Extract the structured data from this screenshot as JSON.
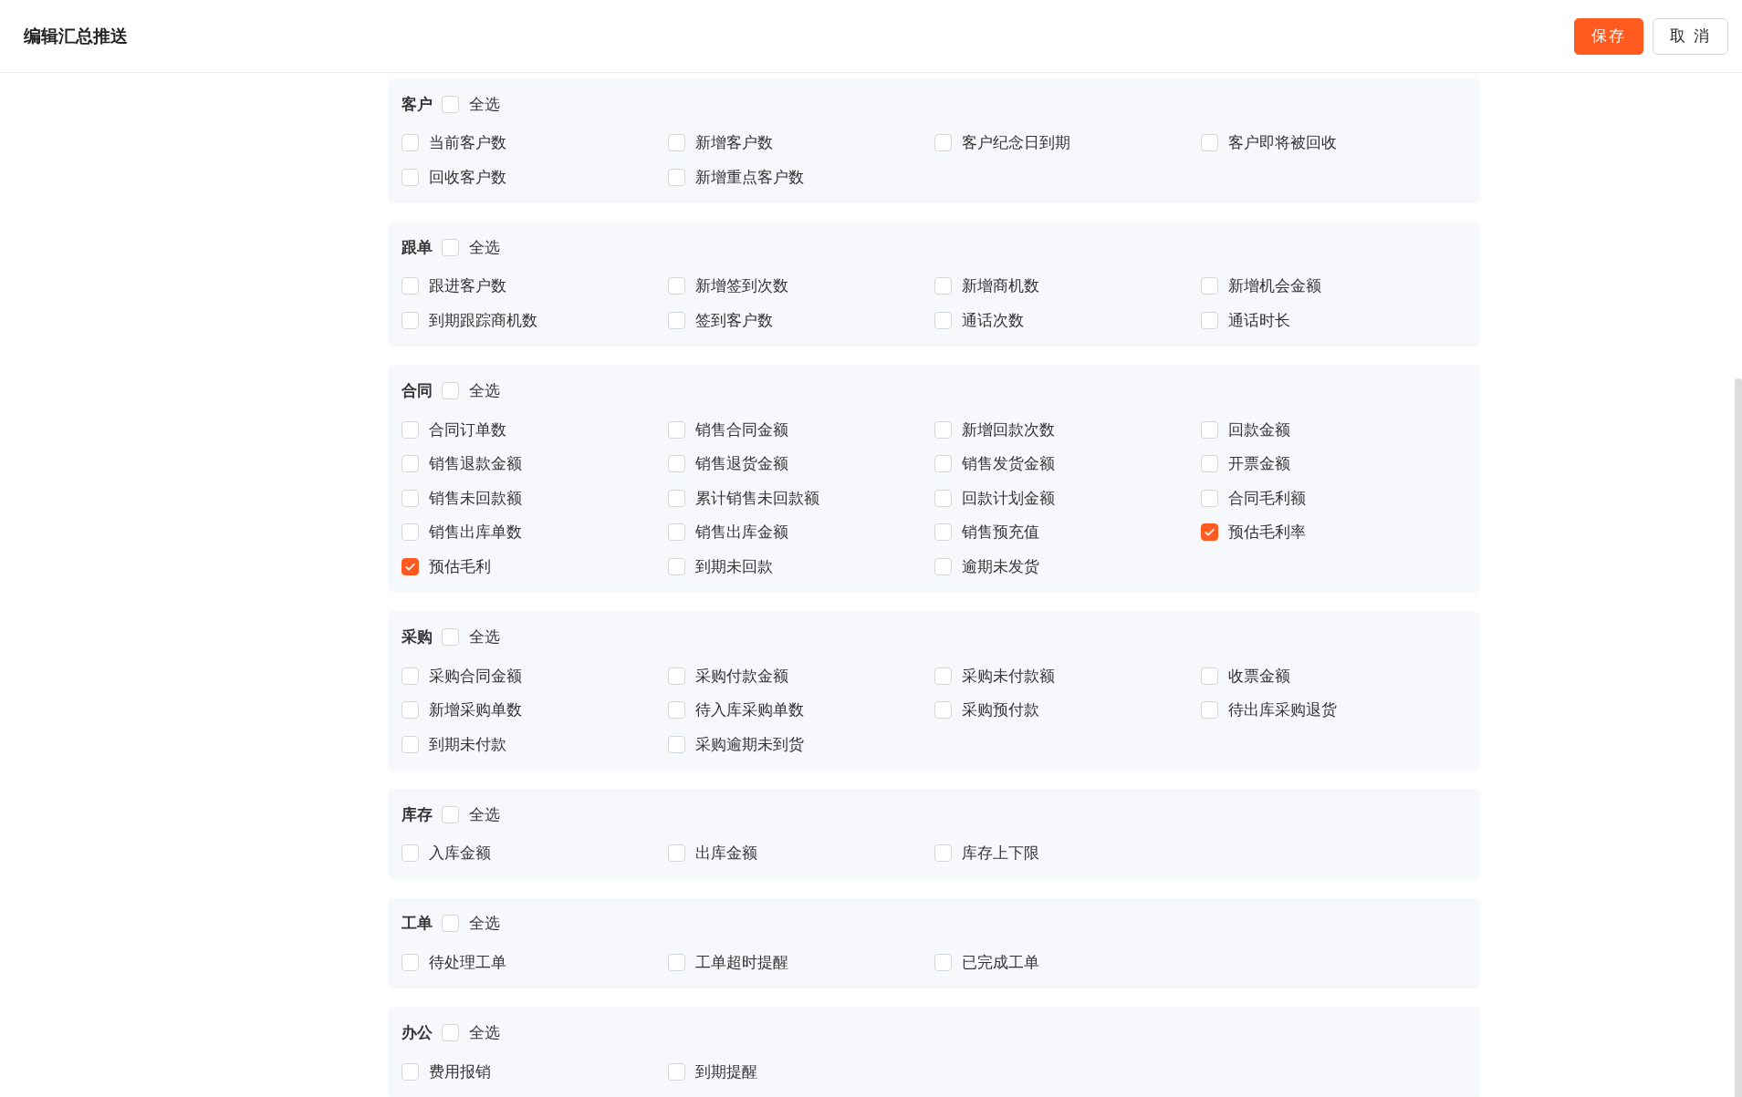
{
  "header": {
    "title": "编辑汇总推送",
    "buttons": [
      {
        "kind": "primary",
        "label": "保存"
      },
      {
        "kind": "default",
        "label": "取 消"
      }
    ]
  },
  "sections": [
    {
      "title": "客户",
      "select_all": {
        "label": "全选",
        "checked": false
      },
      "items": [
        {
          "label": "当前客户数",
          "checked": false
        },
        {
          "label": "新增客户数",
          "checked": false
        },
        {
          "label": "客户纪念日到期",
          "checked": false
        },
        {
          "label": "客户即将被回收",
          "checked": false
        },
        {
          "label": "回收客户数",
          "checked": false
        },
        {
          "label": "新增重点客户数",
          "checked": false
        }
      ]
    },
    {
      "title": "跟单",
      "select_all": {
        "label": "全选",
        "checked": false
      },
      "items": [
        {
          "label": "跟进客户数",
          "checked": false
        },
        {
          "label": "新增签到次数",
          "checked": false
        },
        {
          "label": "新增商机数",
          "checked": false
        },
        {
          "label": "新增机会金额",
          "checked": false
        },
        {
          "label": "到期跟踪商机数",
          "checked": false
        },
        {
          "label": "签到客户数",
          "checked": false
        },
        {
          "label": "通话次数",
          "checked": false
        },
        {
          "label": "通话时长",
          "checked": false
        }
      ]
    },
    {
      "title": "合同",
      "select_all": {
        "label": "全选",
        "checked": false
      },
      "items": [
        {
          "label": "合同订单数",
          "checked": false
        },
        {
          "label": "销售合同金额",
          "checked": false
        },
        {
          "label": "新增回款次数",
          "checked": false
        },
        {
          "label": "回款金额",
          "checked": false
        },
        {
          "label": "销售退款金额",
          "checked": false
        },
        {
          "label": "销售退货金额",
          "checked": false
        },
        {
          "label": "销售发货金额",
          "checked": false
        },
        {
          "label": "开票金额",
          "checked": false
        },
        {
          "label": "销售未回款额",
          "checked": false
        },
        {
          "label": "累计销售未回款额",
          "checked": false
        },
        {
          "label": "回款计划金额",
          "checked": false
        },
        {
          "label": "合同毛利额",
          "checked": false
        },
        {
          "label": "销售出库单数",
          "checked": false
        },
        {
          "label": "销售出库金额",
          "checked": false
        },
        {
          "label": "销售预充值",
          "checked": false
        },
        {
          "label": "预估毛利率",
          "checked": true
        },
        {
          "label": "预估毛利",
          "checked": true
        },
        {
          "label": "到期未回款",
          "checked": false
        },
        {
          "label": "逾期未发货",
          "checked": false
        }
      ]
    },
    {
      "title": "采购",
      "select_all": {
        "label": "全选",
        "checked": false
      },
      "items": [
        {
          "label": "采购合同金额",
          "checked": false
        },
        {
          "label": "采购付款金额",
          "checked": false
        },
        {
          "label": "采购未付款额",
          "checked": false
        },
        {
          "label": "收票金额",
          "checked": false
        },
        {
          "label": "新增采购单数",
          "checked": false
        },
        {
          "label": "待入库采购单数",
          "checked": false
        },
        {
          "label": "采购预付款",
          "checked": false
        },
        {
          "label": "待出库采购退货",
          "checked": false
        },
        {
          "label": "到期未付款",
          "checked": false
        },
        {
          "label": "采购逾期未到货",
          "checked": false
        }
      ]
    },
    {
      "title": "库存",
      "select_all": {
        "label": "全选",
        "checked": false
      },
      "items": [
        {
          "label": "入库金额",
          "checked": false
        },
        {
          "label": "出库金额",
          "checked": false
        },
        {
          "label": "库存上下限",
          "checked": false
        }
      ]
    },
    {
      "title": "工单",
      "select_all": {
        "label": "全选",
        "checked": false
      },
      "items": [
        {
          "label": "待处理工单",
          "checked": false
        },
        {
          "label": "工单超时提醒",
          "checked": false
        },
        {
          "label": "已完成工单",
          "checked": false
        }
      ]
    },
    {
      "title": "办公",
      "select_all": {
        "label": "全选",
        "checked": false
      },
      "items": [
        {
          "label": "费用报销",
          "checked": false
        },
        {
          "label": "到期提醒",
          "checked": false
        }
      ]
    }
  ]
}
